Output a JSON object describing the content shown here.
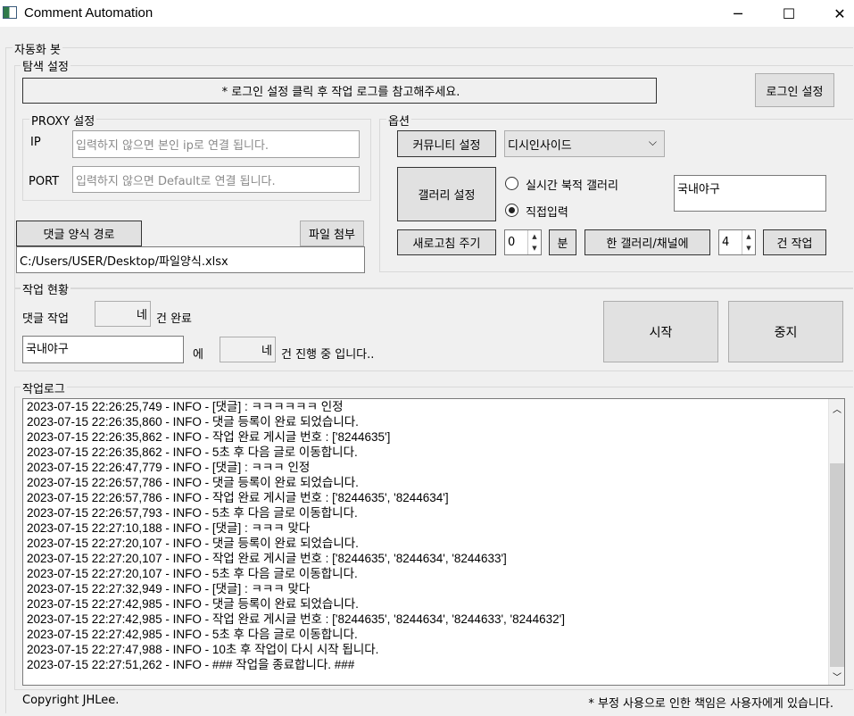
{
  "window": {
    "title": "Comment Automation",
    "minimize": "─",
    "maximize": "☐",
    "close": "✕"
  },
  "bot_group": {
    "label": "자동화 봇"
  },
  "search_group": {
    "label": "탐색 설정",
    "notice": "* 로그인 설정 클릭 후 작업 로그를 참고해주세요.",
    "login_button": "로그인 설정"
  },
  "proxy": {
    "label": "PROXY 설정",
    "ip_label": "IP",
    "ip_placeholder": "입력하지 않으면 본인 ip로 연결 됩니다.",
    "port_label": "PORT",
    "port_placeholder": "입력하지 않으면 Default로 연결 됩니다."
  },
  "file": {
    "path_button": "댓글 양식 경로",
    "attach_button": "파일 첨부",
    "path_value": "C:/Users/USER/Desktop/파일양식.xlsx"
  },
  "options": {
    "label": "옵션",
    "community_button": "커뮤니티 설정",
    "community_selected": "디시인사이드",
    "gallery_button": "갤러리 설정",
    "radio_realtime": "실시간 북적 갤러리",
    "radio_direct": "직접입력",
    "gallery_input": "국내야구",
    "refresh_button": "새로고침 주기",
    "refresh_value": "0",
    "minute_button": "분",
    "per_gallery_button": "한 갤러리/채널에",
    "per_gallery_value": "4",
    "tasks_button": "건 작업"
  },
  "status": {
    "label": "작업 현황",
    "comment_work": "댓글 작업",
    "comment_count": "네",
    "done_suffix": "건 완료",
    "current_gallery": "국내야구",
    "at": "에",
    "progress_count": "네",
    "progress_suffix": "건 진행 중 입니다..",
    "start_button": "시작",
    "stop_button": "중지"
  },
  "log": {
    "label": "작업로그",
    "lines": [
      "2023-07-15 22:26:25,749 - INFO - [댓글] : ㅋㅋㅋㅋㅋㅋ 인정",
      "2023-07-15 22:26:35,860 - INFO - 댓글 등록이 완료 되었습니다.",
      "2023-07-15 22:26:35,862 - INFO - 작업 완료 게시글 번호 : ['8244635']",
      "2023-07-15 22:26:35,862 - INFO - 5초 후 다음 글로 이동합니다.",
      "2023-07-15 22:26:47,779 - INFO - [댓글] : ㅋㅋㅋ 인정",
      "2023-07-15 22:26:57,786 - INFO - 댓글 등록이 완료 되었습니다.",
      "2023-07-15 22:26:57,786 - INFO - 작업 완료 게시글 번호 : ['8244635', '8244634']",
      "2023-07-15 22:26:57,793 - INFO - 5초 후 다음 글로 이동합니다.",
      "2023-07-15 22:27:10,188 - INFO - [댓글] : ㅋㅋㅋ 맞다",
      "2023-07-15 22:27:20,107 - INFO - 댓글 등록이 완료 되었습니다.",
      "2023-07-15 22:27:20,107 - INFO - 작업 완료 게시글 번호 : ['8244635', '8244634', '8244633']",
      "2023-07-15 22:27:20,107 - INFO - 5초 후 다음 글로 이동합니다.",
      "2023-07-15 22:27:32,949 - INFO - [댓글] : ㅋㅋㅋ 맞다",
      "2023-07-15 22:27:42,985 - INFO - 댓글 등록이 완료 되었습니다.",
      "2023-07-15 22:27:42,985 - INFO - 작업 완료 게시글 번호 : ['8244635', '8244634', '8244633', '8244632']",
      "2023-07-15 22:27:42,985 - INFO - 5초 후 다음 글로 이동합니다.",
      "2023-07-15 22:27:47,988 - INFO - 10초 후 작업이 다시 시작 됩니다.",
      "2023-07-15 22:27:51,262 - INFO - ### 작업을 종료합니다. ###"
    ]
  },
  "footer": {
    "copyright": "Copyright JHLee.",
    "disclaimer": "* 부정 사용으로 인한 책임은 사용자에게 있습니다."
  }
}
